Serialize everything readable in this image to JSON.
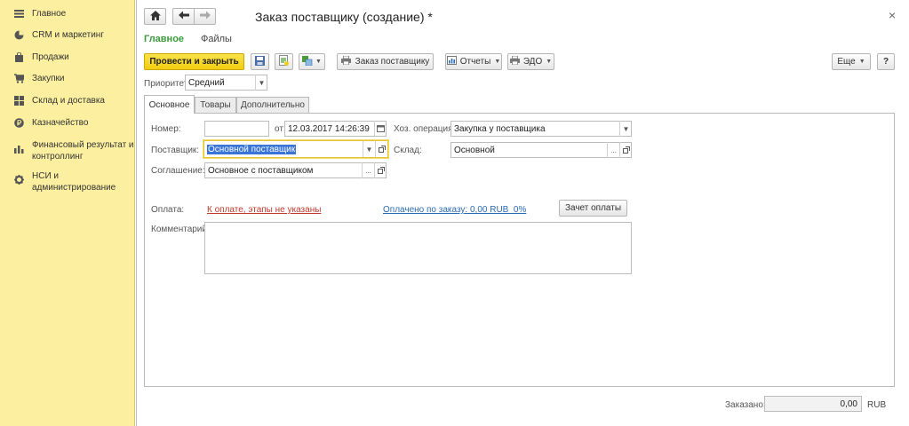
{
  "sidebar": {
    "items": [
      {
        "label": "Главное",
        "icon": "menu-lines-icon"
      },
      {
        "label": "CRM и маркетинг",
        "icon": "pie-chart-icon"
      },
      {
        "label": "Продажи",
        "icon": "shopping-bag-icon"
      },
      {
        "label": "Закупки",
        "icon": "cart-icon"
      },
      {
        "label": "Склад и доставка",
        "icon": "warehouse-icon"
      },
      {
        "label": "Казначейство",
        "icon": "ruble-coin-icon"
      },
      {
        "label": "Финансовый результат и контроллинг",
        "icon": "bar-chart-icon"
      },
      {
        "label": "НСИ и администрирование",
        "icon": "gear-icon"
      }
    ]
  },
  "header": {
    "title": "Заказ поставщику (создание) *",
    "close_glyph": "×"
  },
  "nav_tabs": {
    "main": "Главное",
    "files": "Файлы"
  },
  "toolbar": {
    "post_close_label": "Провести и закрыть",
    "order_label": "Заказ поставщику",
    "reports_label": "Отчеты",
    "edo_label": "ЭДО",
    "more_label": "Еще",
    "help_label": "?"
  },
  "priority": {
    "label": "Приоритет:",
    "value": "Средний"
  },
  "form_tabs": {
    "basic": "Основное",
    "goods": "Товары",
    "extra": "Дополнительно"
  },
  "form": {
    "number_label": "Номер:",
    "number_value": "",
    "date_from_label": "от:",
    "date_value": "12.03.2017 14:26:39",
    "operation_label": "Хоз. операция:",
    "operation_value": "Закупка у поставщика",
    "supplier_label": "Поставщик:",
    "supplier_value": "Основной поставщик",
    "warehouse_label": "Склад:",
    "warehouse_value": "Основной",
    "agreement_label": "Соглашение:",
    "agreement_value": "Основное с поставщиком",
    "payment_label": "Оплата:",
    "payment_link": "К оплате, этапы не указаны",
    "paid_link": "Оплачено по заказу: 0,00 RUB  0%",
    "offset_button": "Зачет оплаты",
    "comment_label": "Комментарий:",
    "comment_value": ""
  },
  "footer": {
    "ordered_label": "Заказано:",
    "ordered_value": "0,00",
    "currency": "RUB"
  },
  "colors": {
    "sidebar_bg": "#fcf0a0",
    "primary_button": "#f5d41c",
    "active_tab_green": "#3a9a3a",
    "link_red": "#c0392b",
    "link_blue": "#2a6bb5",
    "focus_border": "#e8c230"
  }
}
